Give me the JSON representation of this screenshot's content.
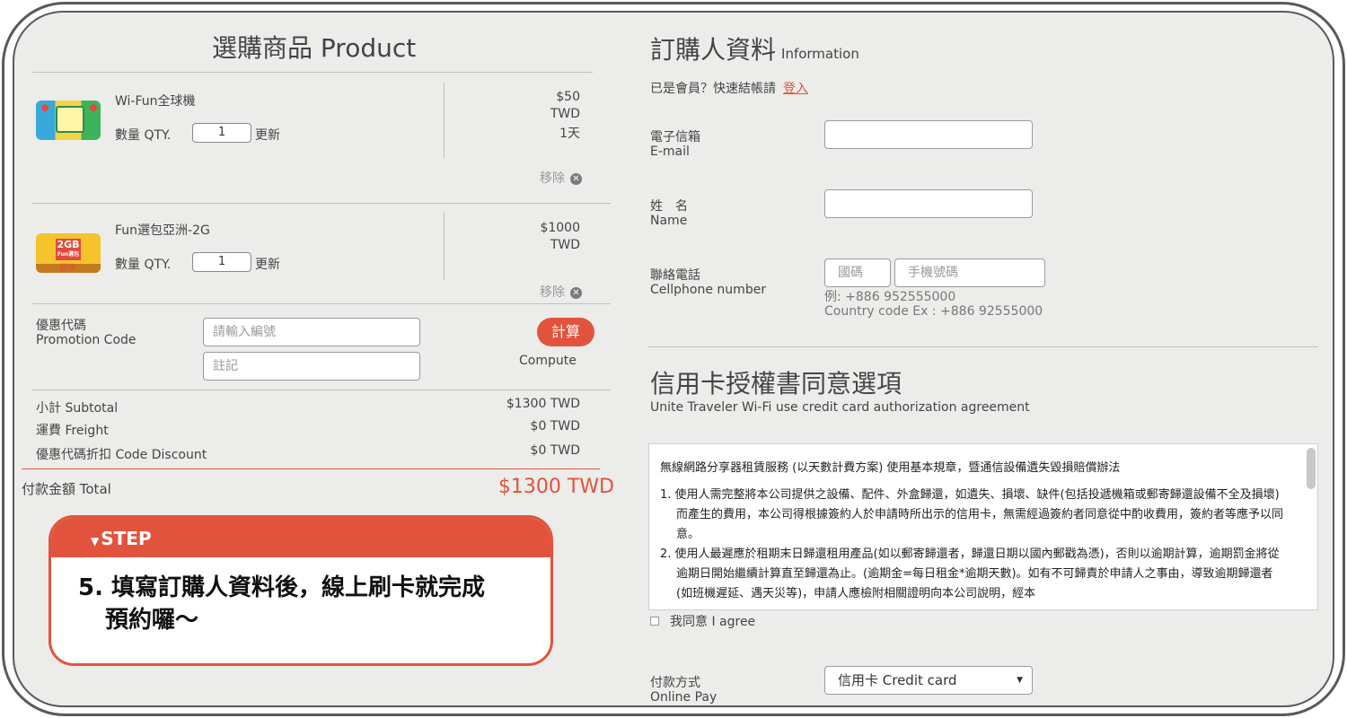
{
  "product_section": {
    "title": "選購商品 Product",
    "items": [
      {
        "name": "Wi-Fun全球機",
        "qty_label": "數量 QTY.",
        "qty": "1",
        "update": "更新",
        "price": "$50",
        "currency": "TWD",
        "period": "1天",
        "remove": "移除",
        "image_icon": "wifi-device-product-icon"
      },
      {
        "name": "Fun選包亞洲-2G",
        "qty_label": "數量 QTY.",
        "qty": "1",
        "update": "更新",
        "price": "$1000",
        "currency": "TWD",
        "period": "",
        "remove": "移除",
        "image_icon": "sim-card-product-icon",
        "image_tag": "2GB",
        "image_tag_sub": "Fun選包",
        "image_sub": "亞洲"
      }
    ],
    "promo": {
      "label_zh": "優惠代碼",
      "label_en": "Promotion Code",
      "code_placeholder": "請輸入編號",
      "note_placeholder": "註記",
      "compute_button": "計算",
      "compute_label": "Compute"
    },
    "summary": [
      {
        "label": "小計 Subtotal",
        "value": "$1300 TWD"
      },
      {
        "label": "運費 Freight",
        "value": "$0 TWD"
      },
      {
        "label": "優惠代碼折扣 Code Discount",
        "value": "$0 TWD"
      }
    ],
    "total": {
      "label": "付款金額 Total",
      "value": "$1300 TWD"
    }
  },
  "step_card": {
    "header": "STEP",
    "line1": "5. 填寫訂購人資料後，線上刷卡就完成",
    "line2": "預約囉～"
  },
  "info_section": {
    "title": "訂購人資料",
    "title_en": "Information",
    "member_prompt": "已是會員？快速結帳請",
    "login_link": "登入",
    "fields": {
      "email": {
        "label_zh": "電子信箱",
        "label_en": "E-mail",
        "value": ""
      },
      "name": {
        "label_zh": "姓　名",
        "label_en": "Name",
        "value": ""
      },
      "phone": {
        "label_zh": "聯絡電話",
        "label_en": "Cellphone number",
        "country_placeholder": "國碼",
        "number_placeholder": "手機號碼",
        "hint1": "例: +886 952555000",
        "hint2": "Country code Ex : +886 92555000"
      }
    }
  },
  "credit_card_section": {
    "title": "信用卡授權書同意選項",
    "subtitle": "Unite Traveler Wi-Fi use credit card authorization agreement",
    "agreement_heading": "無線網路分享器租賃服務 (以天數計費方案) 使用基本規章，暨通信設備遺失毀損賠償辦法",
    "clauses": [
      "1. 使用人需完整將本公司提供之設備、配件、外盒歸還，如遺失、損壞、缺件(包括投遞機箱或郵寄歸還設備不全及損壞)而產生的費用，本公司得根據簽約人於申請時所出示的信用卡，無需經過簽約者同意從中酌收費用，簽約者等應予以同意。",
      "2. 使用人最遲應於租期末日歸還租用產品(如以郵寄歸還者，歸還日期以國內郵戳為憑)，否則以逾期計算，逾期罰金將從逾期日開始繼續計算直至歸還為止。(逾期金=每日租金*逾期天數)。如有不可歸責於申請人之事由，導致逾期歸還者(如班機遲延、遇天災等)，申請人應檢附相關證明向本公司說明，經本"
    ],
    "agree_label": "我同意 I agree",
    "payment": {
      "label_zh": "付款方式",
      "label_en": "Online Pay",
      "selected": "信用卡 Credit card"
    }
  }
}
